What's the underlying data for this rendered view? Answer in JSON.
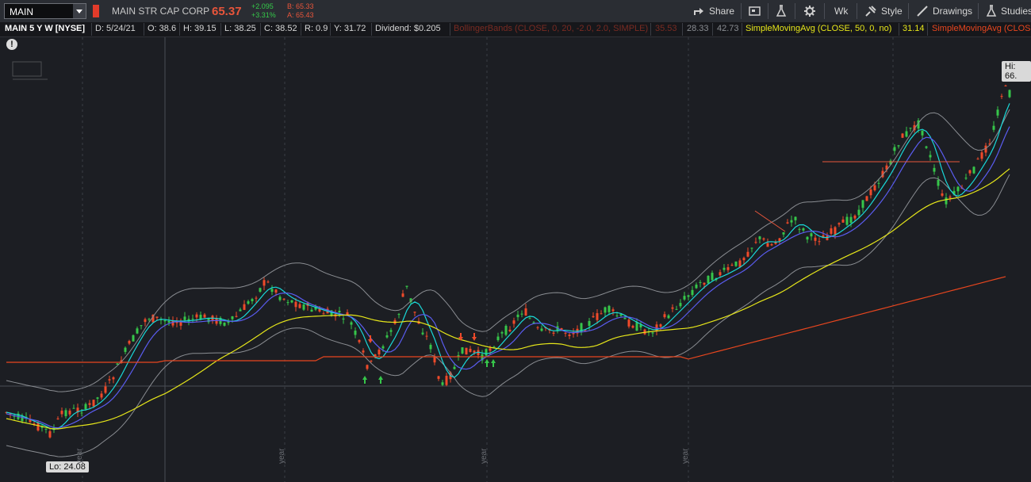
{
  "toolbar": {
    "symbol": "MAIN",
    "company": "MAIN STR CAP CORP",
    "last_price": "65.37",
    "change": "+2.095",
    "change_pct": "+3.31%",
    "bid": "B: 65.33",
    "ask": "A: 65.43",
    "share_label": "Share",
    "timeframe_label": "Wk",
    "style_label": "Style",
    "drawings_label": "Drawings",
    "studies_label": "Studies"
  },
  "infobar": {
    "title": "MAIN 5 Y W [NYSE]",
    "date": "D: 5/24/21",
    "open": "O: 38.6",
    "high": "H: 39.15",
    "low": "L: 38.25",
    "close": "C: 38.52",
    "range": "R: 0.9",
    "year": "Y: 31.72",
    "dividend": "Dividend: $0.205",
    "bb_label": "BollingerBands (CLOSE, 0, 20, -2.0, 2.0, SIMPLE)",
    "bb_v1": "35.53",
    "bb_v2": "28.33",
    "bb_v3": "42.73",
    "sma50_label": "SimpleMovingAvg (CLOSE, 50, 0, no)",
    "sma50_val": "31.14",
    "sma_red_label": "SimpleMovingAvg (CLOSE"
  },
  "chart": {
    "hi_label": "Hi: 66.",
    "lo_label": "Lo: 24.08",
    "x_labels": [
      "year",
      "year",
      "year",
      "year"
    ],
    "colors": {
      "up": "#36c64a",
      "down": "#ef4a2a",
      "cyan": "#19d9d9",
      "blue": "#5a5cf0",
      "yellow": "#e6e61a",
      "red": "#e8461e",
      "band": "#8a8d92"
    }
  },
  "icons": {
    "share": "share-icon",
    "news": "news-icon",
    "flask": "flask-icon",
    "settings": "gear-icon",
    "style": "style-icon",
    "drawings": "pencil-icon",
    "studies": "studies-icon"
  }
}
